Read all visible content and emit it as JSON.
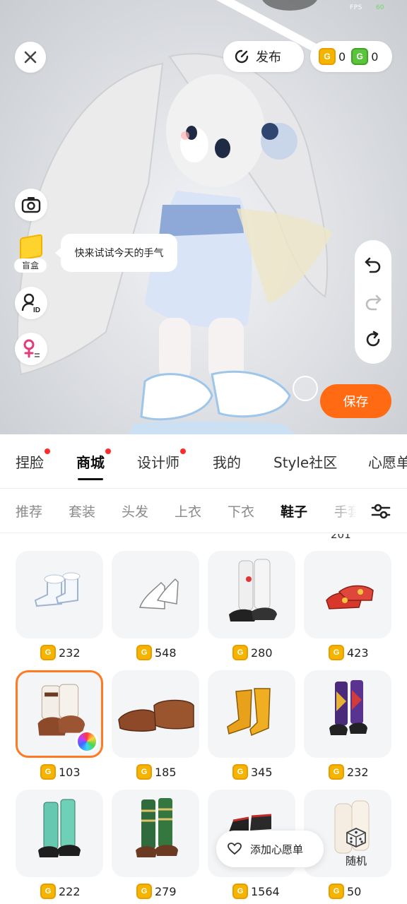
{
  "status_bar": {
    "fps_label": "FPS",
    "fps_value": "60"
  },
  "top_bar": {
    "close_icon": "close-icon",
    "publish_label": "发布",
    "gold_coin_count": "0",
    "green_coin_count": "0",
    "coin_glyph": "G"
  },
  "left_tools": {
    "camera_icon": "camera-icon",
    "blindbox_label": "盲盒",
    "tip_text": "快来试试今天的手气",
    "id_icon": "id-icon",
    "gender_icon": "female-switch-icon"
  },
  "right_tools": {
    "undo_icon": "undo-icon",
    "redo_icon": "redo-icon",
    "reset_icon": "reset-icon",
    "save_label": "保存"
  },
  "main_tabs": [
    {
      "label": "捏脸",
      "dot": true
    },
    {
      "label": "商城",
      "dot": true,
      "active": true
    },
    {
      "label": "设计师",
      "dot": true
    },
    {
      "label": "我的",
      "dot": false
    },
    {
      "label": "Style社区",
      "dot": false
    },
    {
      "label": "心愿单",
      "dot": false
    }
  ],
  "sub_tabs": [
    {
      "label": "推荐"
    },
    {
      "label": "套装"
    },
    {
      "label": "头发"
    },
    {
      "label": "上衣"
    },
    {
      "label": "下衣"
    },
    {
      "label": "鞋子",
      "active": true
    },
    {
      "label": "手套"
    }
  ],
  "filter_icon": "sliders-icon",
  "prev_row_partial_price": "201",
  "items": [
    {
      "name": "白色蝴蝶结短靴",
      "price": "232",
      "icon": "white-boots-icon"
    },
    {
      "name": "白色高跟鞋",
      "price": "548",
      "icon": "white-heels-icon"
    },
    {
      "name": "白色袜套黑鞋",
      "price": "280",
      "icon": "leg-warmers-shoes-icon"
    },
    {
      "name": "红色绣花鞋",
      "price": "423",
      "icon": "red-embroidered-shoes-icon"
    },
    {
      "name": "毛绒棕色靴",
      "price": "103",
      "icon": "fluffy-brown-boots-icon",
      "selected": true
    },
    {
      "name": "棕色爪子鞋",
      "price": "185",
      "icon": "brown-paw-shoes-icon"
    },
    {
      "name": "黄色长靴",
      "price": "345",
      "icon": "yellow-boots-icon"
    },
    {
      "name": "紫色格纹靴",
      "price": "232",
      "icon": "purple-argyle-boots-icon"
    },
    {
      "name": "青色长靴",
      "price": "222",
      "icon": "teal-boots-icon"
    },
    {
      "name": "绿色条纹长靴",
      "price": "279",
      "icon": "green-striped-boots-icon"
    },
    {
      "name": "黑红靴",
      "price": "1564",
      "icon": "black-red-boots-icon"
    },
    {
      "name": "米白袜靴",
      "price": "50",
      "icon": "cream-sock-boots-icon"
    }
  ],
  "wishlist": {
    "label": "添加心愿单",
    "icon": "heart-icon"
  },
  "random": {
    "label": "随机",
    "icon": "dice-icon"
  },
  "colors": {
    "accent": "#ff6a13",
    "selected_border": "#ff7a21",
    "red_dot": "#ff2a2a",
    "gold": "#f4b400",
    "green": "#5cc43c"
  }
}
